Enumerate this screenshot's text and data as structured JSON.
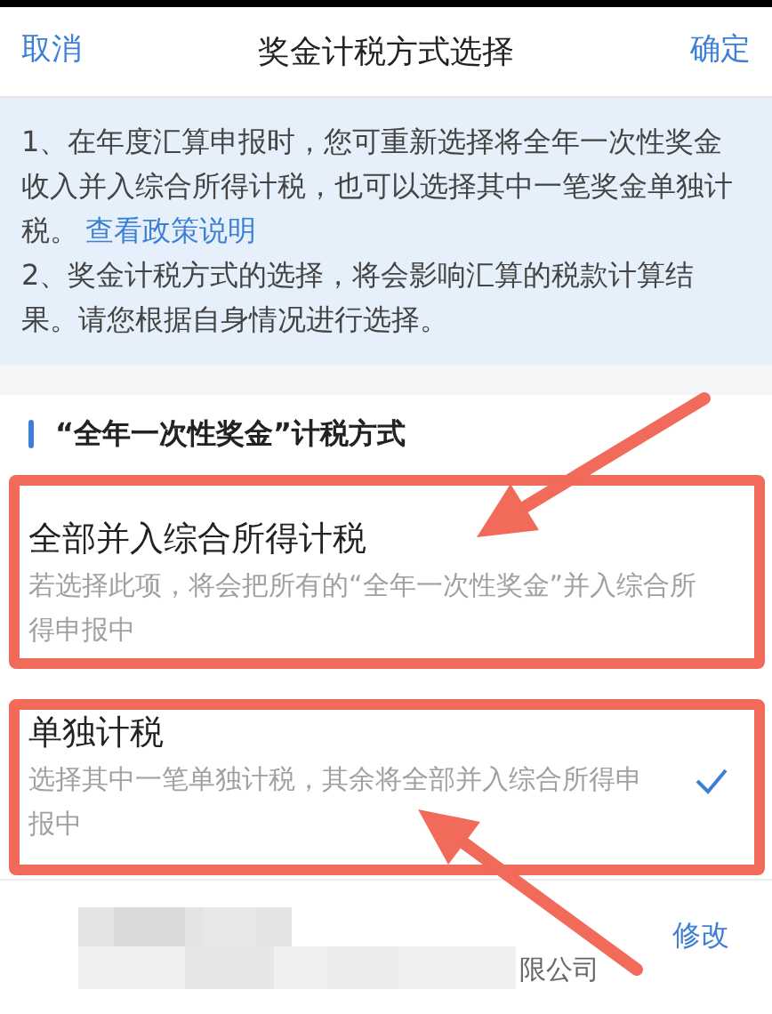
{
  "header": {
    "cancel": "取消",
    "title": "奖金计税方式选择",
    "confirm": "确定"
  },
  "notice": {
    "line_1": "1、在年度汇算申报时，您可重新选择将全年一次性奖金收入并入综合所得计税，也可以选择其中一笔奖金单独计税。",
    "link": "查看政策说明",
    "line_2": "2、奖金计税方式的选择，将会影响汇算的税款计算结果。请您根据自身情况进行选择。"
  },
  "section_title": "“全年一次性奖金”计税方式",
  "options": [
    {
      "title": "全部并入综合所得计税",
      "description": "若选择此项，将会把所有的“全年一次性奖金”并入综合所得申报中",
      "selected": false
    },
    {
      "title": "单独计税",
      "description": "选择其中一笔单独计税，其余将全部并入综合所得申报中",
      "selected": true
    }
  ],
  "employer": {
    "name_tail": "限公司",
    "edit": "修改"
  }
}
